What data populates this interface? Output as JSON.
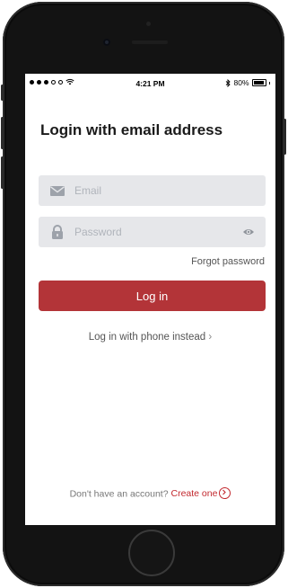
{
  "status_bar": {
    "time": "4:21 PM",
    "battery": "80%",
    "battery_level": 0.8,
    "bluetooth_icon": "bluetooth-icon",
    "wifi_icon": "wifi-icon"
  },
  "login": {
    "title": "Login with email address",
    "email_placeholder": "Email",
    "password_placeholder": "Password",
    "forgot_password": "Forgot password",
    "login_button": "Log in",
    "phone_link": "Log in with phone instead",
    "phone_link_chevron": "›",
    "signup_prompt": "Don't have an account?",
    "signup_link": "Create one"
  },
  "colors": {
    "accent": "#b33438",
    "link": "#c2282e",
    "field_bg": "#e6e7ea",
    "icon": "#9da2aa"
  }
}
